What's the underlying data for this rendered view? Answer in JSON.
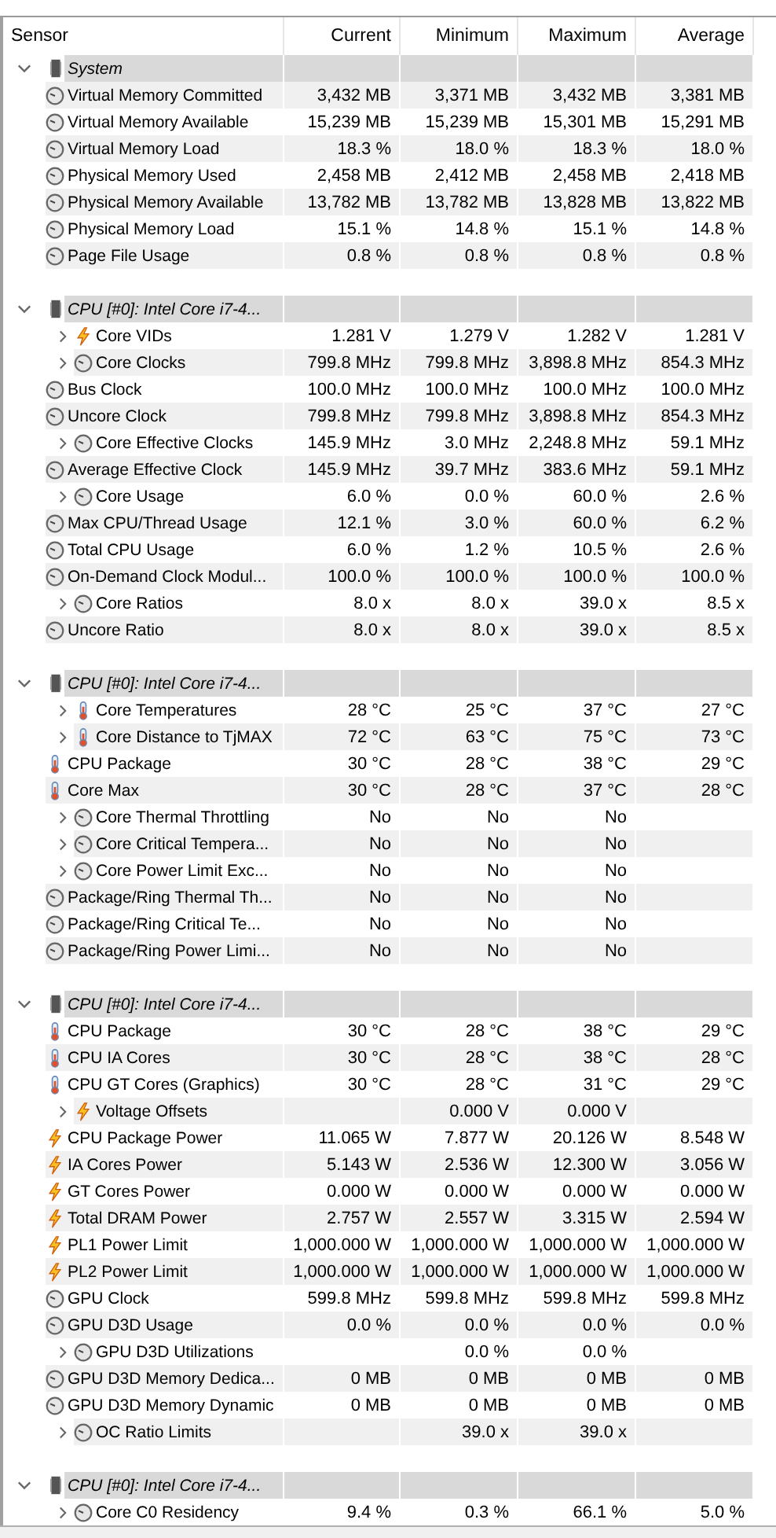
{
  "columns": [
    "Sensor",
    "Current",
    "Minimum",
    "Maximum",
    "Average"
  ],
  "groups": [
    {
      "name": "System",
      "expanded": true,
      "rows": [
        {
          "name": "Virtual Memory Committed",
          "kind": "clock",
          "expandable": false,
          "current": "3,432 MB",
          "minimum": "3,371 MB",
          "maximum": "3,432 MB",
          "average": "3,381 MB"
        },
        {
          "name": "Virtual Memory Available",
          "kind": "clock",
          "expandable": false,
          "current": "15,239 MB",
          "minimum": "15,239 MB",
          "maximum": "15,301 MB",
          "average": "15,291 MB"
        },
        {
          "name": "Virtual Memory Load",
          "kind": "clock",
          "expandable": false,
          "current": "18.3 %",
          "minimum": "18.0 %",
          "maximum": "18.3 %",
          "average": "18.0 %"
        },
        {
          "name": "Physical Memory Used",
          "kind": "clock",
          "expandable": false,
          "current": "2,458 MB",
          "minimum": "2,412 MB",
          "maximum": "2,458 MB",
          "average": "2,418 MB"
        },
        {
          "name": "Physical Memory Available",
          "kind": "clock",
          "expandable": false,
          "current": "13,782 MB",
          "minimum": "13,782 MB",
          "maximum": "13,828 MB",
          "average": "13,822 MB"
        },
        {
          "name": "Physical Memory Load",
          "kind": "clock",
          "expandable": false,
          "current": "15.1 %",
          "minimum": "14.8 %",
          "maximum": "15.1 %",
          "average": "14.8 %"
        },
        {
          "name": "Page File Usage",
          "kind": "clock",
          "expandable": false,
          "current": "0.8 %",
          "minimum": "0.8 %",
          "maximum": "0.8 %",
          "average": "0.8 %"
        }
      ]
    },
    {
      "name": "CPU [#0]: Intel Core i7-4...",
      "expanded": true,
      "rows": [
        {
          "name": "Core VIDs",
          "kind": "bolt",
          "expandable": true,
          "current": "1.281 V",
          "minimum": "1.279 V",
          "maximum": "1.282 V",
          "average": "1.281 V"
        },
        {
          "name": "Core Clocks",
          "kind": "clock",
          "expandable": true,
          "current": "799.8 MHz",
          "minimum": "799.8 MHz",
          "maximum": "3,898.8 MHz",
          "average": "854.3 MHz"
        },
        {
          "name": "Bus Clock",
          "kind": "clock",
          "expandable": false,
          "current": "100.0 MHz",
          "minimum": "100.0 MHz",
          "maximum": "100.0 MHz",
          "average": "100.0 MHz"
        },
        {
          "name": "Uncore Clock",
          "kind": "clock",
          "expandable": false,
          "current": "799.8 MHz",
          "minimum": "799.8 MHz",
          "maximum": "3,898.8 MHz",
          "average": "854.3 MHz"
        },
        {
          "name": "Core Effective Clocks",
          "kind": "clock",
          "expandable": true,
          "current": "145.9 MHz",
          "minimum": "3.0 MHz",
          "maximum": "2,248.8 MHz",
          "average": "59.1 MHz"
        },
        {
          "name": "Average Effective Clock",
          "kind": "clock",
          "expandable": false,
          "current": "145.9 MHz",
          "minimum": "39.7 MHz",
          "maximum": "383.6 MHz",
          "average": "59.1 MHz"
        },
        {
          "name": "Core Usage",
          "kind": "clock",
          "expandable": true,
          "current": "6.0 %",
          "minimum": "0.0 %",
          "maximum": "60.0 %",
          "average": "2.6 %"
        },
        {
          "name": "Max CPU/Thread Usage",
          "kind": "clock",
          "expandable": false,
          "current": "12.1 %",
          "minimum": "3.0 %",
          "maximum": "60.0 %",
          "average": "6.2 %"
        },
        {
          "name": "Total CPU Usage",
          "kind": "clock",
          "expandable": false,
          "current": "6.0 %",
          "minimum": "1.2 %",
          "maximum": "10.5 %",
          "average": "2.6 %"
        },
        {
          "name": "On-Demand Clock Modul...",
          "kind": "clock",
          "expandable": false,
          "current": "100.0 %",
          "minimum": "100.0 %",
          "maximum": "100.0 %",
          "average": "100.0 %"
        },
        {
          "name": "Core Ratios",
          "kind": "clock",
          "expandable": true,
          "current": "8.0 x",
          "minimum": "8.0 x",
          "maximum": "39.0 x",
          "average": "8.5 x"
        },
        {
          "name": "Uncore Ratio",
          "kind": "clock",
          "expandable": false,
          "current": "8.0 x",
          "minimum": "8.0 x",
          "maximum": "39.0 x",
          "average": "8.5 x"
        }
      ]
    },
    {
      "name": "CPU [#0]: Intel Core i7-4...",
      "expanded": true,
      "rows": [
        {
          "name": "Core Temperatures",
          "kind": "thermometer",
          "expandable": true,
          "current": "28 °C",
          "minimum": "25 °C",
          "maximum": "37 °C",
          "average": "27 °C"
        },
        {
          "name": "Core Distance to TjMAX",
          "kind": "thermometer",
          "expandable": true,
          "current": "72 °C",
          "minimum": "63 °C",
          "maximum": "75 °C",
          "average": "73 °C"
        },
        {
          "name": "CPU Package",
          "kind": "thermometer",
          "expandable": false,
          "current": "30 °C",
          "minimum": "28 °C",
          "maximum": "38 °C",
          "average": "29 °C"
        },
        {
          "name": "Core Max",
          "kind": "thermometer",
          "expandable": false,
          "current": "30 °C",
          "minimum": "28 °C",
          "maximum": "37 °C",
          "average": "28 °C"
        },
        {
          "name": "Core Thermal Throttling",
          "kind": "clock",
          "expandable": true,
          "current": "No",
          "minimum": "No",
          "maximum": "No"
        },
        {
          "name": "Core Critical Tempera...",
          "kind": "clock",
          "expandable": true,
          "current": "No",
          "minimum": "No",
          "maximum": "No"
        },
        {
          "name": "Core Power Limit Exc...",
          "kind": "clock",
          "expandable": true,
          "current": "No",
          "minimum": "No",
          "maximum": "No"
        },
        {
          "name": "Package/Ring Thermal Th...",
          "kind": "clock",
          "expandable": false,
          "current": "No",
          "minimum": "No",
          "maximum": "No"
        },
        {
          "name": "Package/Ring Critical Te...",
          "kind": "clock",
          "expandable": false,
          "current": "No",
          "minimum": "No",
          "maximum": "No"
        },
        {
          "name": "Package/Ring Power Limi...",
          "kind": "clock",
          "expandable": false,
          "current": "No",
          "minimum": "No",
          "maximum": "No"
        }
      ]
    },
    {
      "name": "CPU [#0]: Intel Core i7-4...",
      "expanded": true,
      "rows": [
        {
          "name": "CPU Package",
          "kind": "thermometer",
          "expandable": false,
          "current": "30 °C",
          "minimum": "28 °C",
          "maximum": "38 °C",
          "average": "29 °C"
        },
        {
          "name": "CPU IA Cores",
          "kind": "thermometer",
          "expandable": false,
          "current": "30 °C",
          "minimum": "28 °C",
          "maximum": "38 °C",
          "average": "28 °C"
        },
        {
          "name": "CPU GT Cores (Graphics)",
          "kind": "thermometer",
          "expandable": false,
          "current": "30 °C",
          "minimum": "28 °C",
          "maximum": "31 °C",
          "average": "29 °C"
        },
        {
          "name": "Voltage Offsets",
          "kind": "bolt",
          "expandable": true,
          "minimum": "0.000 V",
          "maximum": "0.000 V"
        },
        {
          "name": "CPU Package Power",
          "kind": "bolt",
          "expandable": false,
          "current": "11.065 W",
          "minimum": "7.877 W",
          "maximum": "20.126 W",
          "average": "8.548 W"
        },
        {
          "name": "IA Cores Power",
          "kind": "bolt",
          "expandable": false,
          "current": "5.143 W",
          "minimum": "2.536 W",
          "maximum": "12.300 W",
          "average": "3.056 W"
        },
        {
          "name": "GT Cores Power",
          "kind": "bolt",
          "expandable": false,
          "current": "0.000 W",
          "minimum": "0.000 W",
          "maximum": "0.000 W",
          "average": "0.000 W"
        },
        {
          "name": "Total DRAM Power",
          "kind": "bolt",
          "expandable": false,
          "current": "2.757 W",
          "minimum": "2.557 W",
          "maximum": "3.315 W",
          "average": "2.594 W"
        },
        {
          "name": "PL1 Power Limit",
          "kind": "bolt",
          "expandable": false,
          "current": "1,000.000 W",
          "minimum": "1,000.000 W",
          "maximum": "1,000.000 W",
          "average": "1,000.000 W"
        },
        {
          "name": "PL2 Power Limit",
          "kind": "bolt",
          "expandable": false,
          "current": "1,000.000 W",
          "minimum": "1,000.000 W",
          "maximum": "1,000.000 W",
          "average": "1,000.000 W"
        },
        {
          "name": "GPU Clock",
          "kind": "clock",
          "expandable": false,
          "current": "599.8 MHz",
          "minimum": "599.8 MHz",
          "maximum": "599.8 MHz",
          "average": "599.8 MHz"
        },
        {
          "name": "GPU D3D Usage",
          "kind": "clock",
          "expandable": false,
          "current": "0.0 %",
          "minimum": "0.0 %",
          "maximum": "0.0 %",
          "average": "0.0 %"
        },
        {
          "name": "GPU D3D Utilizations",
          "kind": "clock",
          "expandable": true,
          "minimum": "0.0 %",
          "maximum": "0.0 %"
        },
        {
          "name": "GPU D3D Memory Dedica...",
          "kind": "clock",
          "expandable": false,
          "current": "0 MB",
          "minimum": "0 MB",
          "maximum": "0 MB",
          "average": "0 MB"
        },
        {
          "name": "GPU D3D Memory Dynamic",
          "kind": "clock",
          "expandable": false,
          "current": "0 MB",
          "minimum": "0 MB",
          "maximum": "0 MB",
          "average": "0 MB"
        },
        {
          "name": "OC Ratio Limits",
          "kind": "clock",
          "expandable": true,
          "minimum": "39.0 x",
          "maximum": "39.0 x"
        }
      ]
    },
    {
      "name": "CPU [#0]: Intel Core i7-4...",
      "expanded": true,
      "rows": [
        {
          "name": "Core C0 Residency",
          "kind": "clock",
          "expandable": true,
          "current": "9.4 %",
          "minimum": "0.3 %",
          "maximum": "66.1 %",
          "average": "5.0 %"
        }
      ]
    }
  ]
}
